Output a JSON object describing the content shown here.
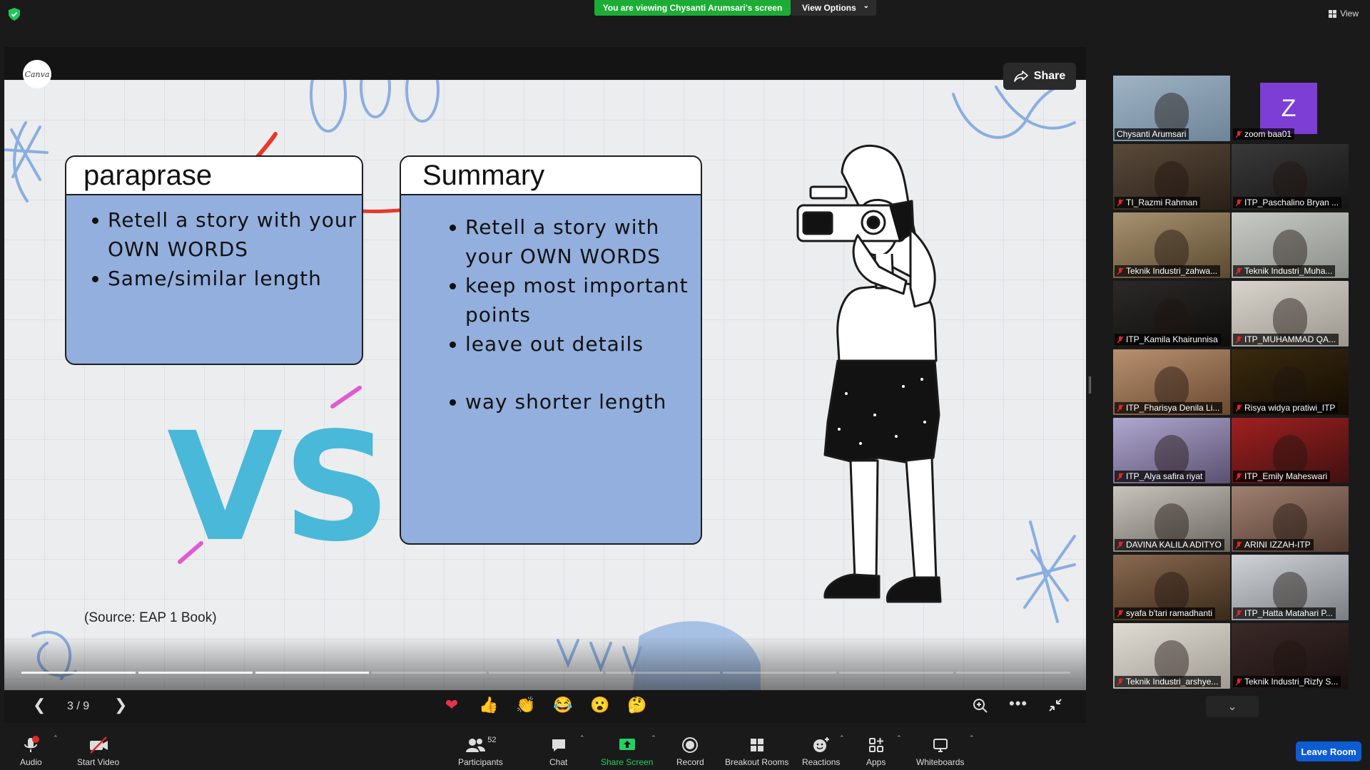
{
  "meeting": {
    "viewing_banner": "You are viewing Chysanti Arumsari's screen",
    "view_options_label": "View Options",
    "view_label": "View"
  },
  "share": {
    "canva_logo": "Canva",
    "share_label": "Share",
    "page_indicator": "3 / 9",
    "total_pages": 9,
    "current_page": 3
  },
  "slide": {
    "paraphrase": {
      "title": "paraprase",
      "bullets": [
        "Retell a story with your OWN WORDS",
        "Same/similar length"
      ]
    },
    "summary": {
      "title": "Summary",
      "bullets": [
        "Retell a story with your OWN WORDS",
        "keep most important points",
        "leave out details",
        "way shorter length"
      ]
    },
    "vs_text": "VS",
    "source": "(Source: EAP 1 Book)",
    "colors": {
      "card_blue": "#92afdd",
      "vs_blue": "#4ab8d8",
      "pen_red": "#e8392a",
      "accent_pink": "#e05ad0"
    }
  },
  "reactions": [
    "heart-emoji",
    "thumbs-up-emoji",
    "clap-emoji",
    "joy-emoji",
    "open-mouth-emoji",
    "thinking-emoji"
  ],
  "participants_gallery": [
    {
      "name": "Chysanti Arumsari",
      "muted": false,
      "active": true,
      "kind": "video"
    },
    {
      "name": "zoom baa01",
      "muted": true,
      "active": false,
      "kind": "avatar",
      "initial": "Z"
    },
    {
      "name": "TI_Razmi Rahman",
      "muted": true,
      "kind": "video"
    },
    {
      "name": "ITP_Paschalino Bryan ...",
      "muted": true,
      "kind": "video"
    },
    {
      "name": "Teknik Industri_zahwa...",
      "muted": true,
      "kind": "video"
    },
    {
      "name": "Teknik Industri_Muha...",
      "muted": true,
      "kind": "video"
    },
    {
      "name": "ITP_Kamila Khairunnisa",
      "muted": true,
      "kind": "video"
    },
    {
      "name": "ITP_MUHAMMAD QA...",
      "muted": true,
      "kind": "video"
    },
    {
      "name": "ITP_Fharisya Denila Li...",
      "muted": true,
      "kind": "video"
    },
    {
      "name": "Risya widya pratiwi_ITP",
      "muted": true,
      "kind": "video"
    },
    {
      "name": "ITP_Alya safira riyat",
      "muted": true,
      "kind": "video"
    },
    {
      "name": "ITP_Emily Maheswari",
      "muted": true,
      "kind": "video"
    },
    {
      "name": "DAVINA KALILA ADITYO",
      "muted": true,
      "kind": "video"
    },
    {
      "name": "ARINI IZZAH-ITP",
      "muted": true,
      "kind": "video"
    },
    {
      "name": "syafa b'tari ramadhanti",
      "muted": true,
      "kind": "video"
    },
    {
      "name": "ITP_Hatta Matahari P...",
      "muted": true,
      "kind": "video"
    },
    {
      "name": "Teknik Industri_arshye...",
      "muted": true,
      "kind": "video"
    },
    {
      "name": "Teknik Industri_Rizfy S...",
      "muted": true,
      "kind": "video"
    }
  ],
  "toolbar": {
    "audio": "Audio",
    "start_video": "Start Video",
    "participants": "Participants",
    "participants_count": "52",
    "chat": "Chat",
    "share_screen": "Share Screen",
    "record": "Record",
    "breakout_rooms": "Breakout Rooms",
    "reactions": "Reactions",
    "apps": "Apps",
    "whiteboards": "Whiteboards",
    "leave_room": "Leave Room",
    "audio_alert": "!"
  }
}
